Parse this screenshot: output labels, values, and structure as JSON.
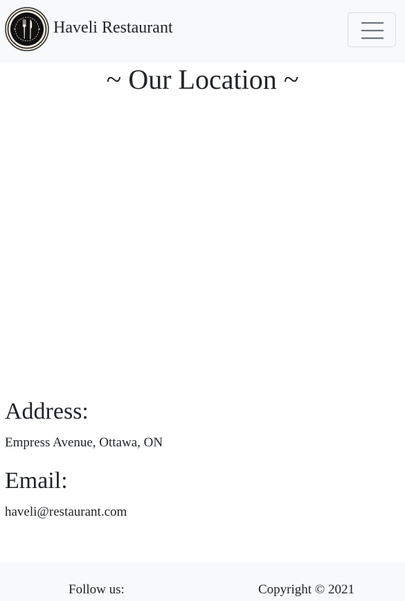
{
  "navbar": {
    "brand_name": "Haveli Restaurant",
    "logo_icon": "fork-and-knife-icon",
    "toggler_icon": "hamburger-menu-icon",
    "background": "#f8f9fa"
  },
  "main": {
    "title": "~ Our Location ~",
    "address_heading": "Address:",
    "address_value": "Empress Avenue, Ottawa, ON",
    "email_heading": "Email:",
    "email_value": "haveli@restaurant.com"
  },
  "footer": {
    "follow_label": "Follow us:",
    "copyright": "Copyright © 2021"
  }
}
